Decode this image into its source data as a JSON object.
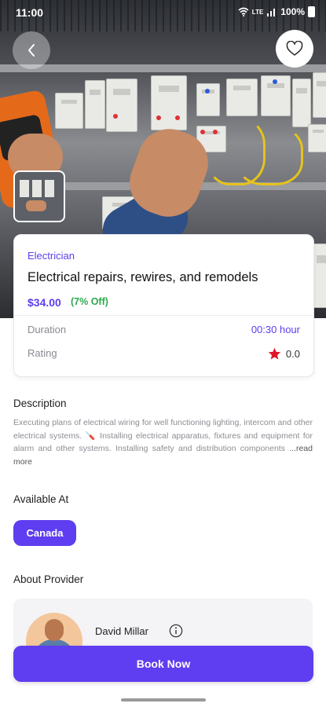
{
  "status_bar": {
    "time": "11:00",
    "network": "LTE",
    "battery": "100%"
  },
  "hero": {
    "image_alt": "Electrician working on electrical panel"
  },
  "service": {
    "category": "Electrician",
    "title": "Electrical repairs, rewires, and remodels",
    "price": "$34.00",
    "discount": "(7% Off)",
    "duration_label": "Duration",
    "duration_value": "00:30 hour",
    "rating_label": "Rating",
    "rating_value": "0.0"
  },
  "description": {
    "heading": "Description",
    "text": "Executing plans of electrical wiring for well functioning lighting, intercom and other electrical systems. 🪛 Installing electrical apparatus, fixtures and equipment for alarm and other systems. Installing safety and distribution components ",
    "more": "...read more"
  },
  "available": {
    "heading": "Available At",
    "locations": [
      "Canada"
    ]
  },
  "provider": {
    "heading": "About Provider",
    "name": "David Millar"
  },
  "actions": {
    "book_now": "Book Now"
  },
  "colors": {
    "accent": "#5f3df0",
    "discount": "#2fa84f",
    "star": "#e0142a"
  },
  "icons": [
    "back-arrow-icon",
    "heart-icon",
    "star-icon",
    "info-icon",
    "wifi-icon",
    "signal-icon",
    "battery-icon"
  ]
}
